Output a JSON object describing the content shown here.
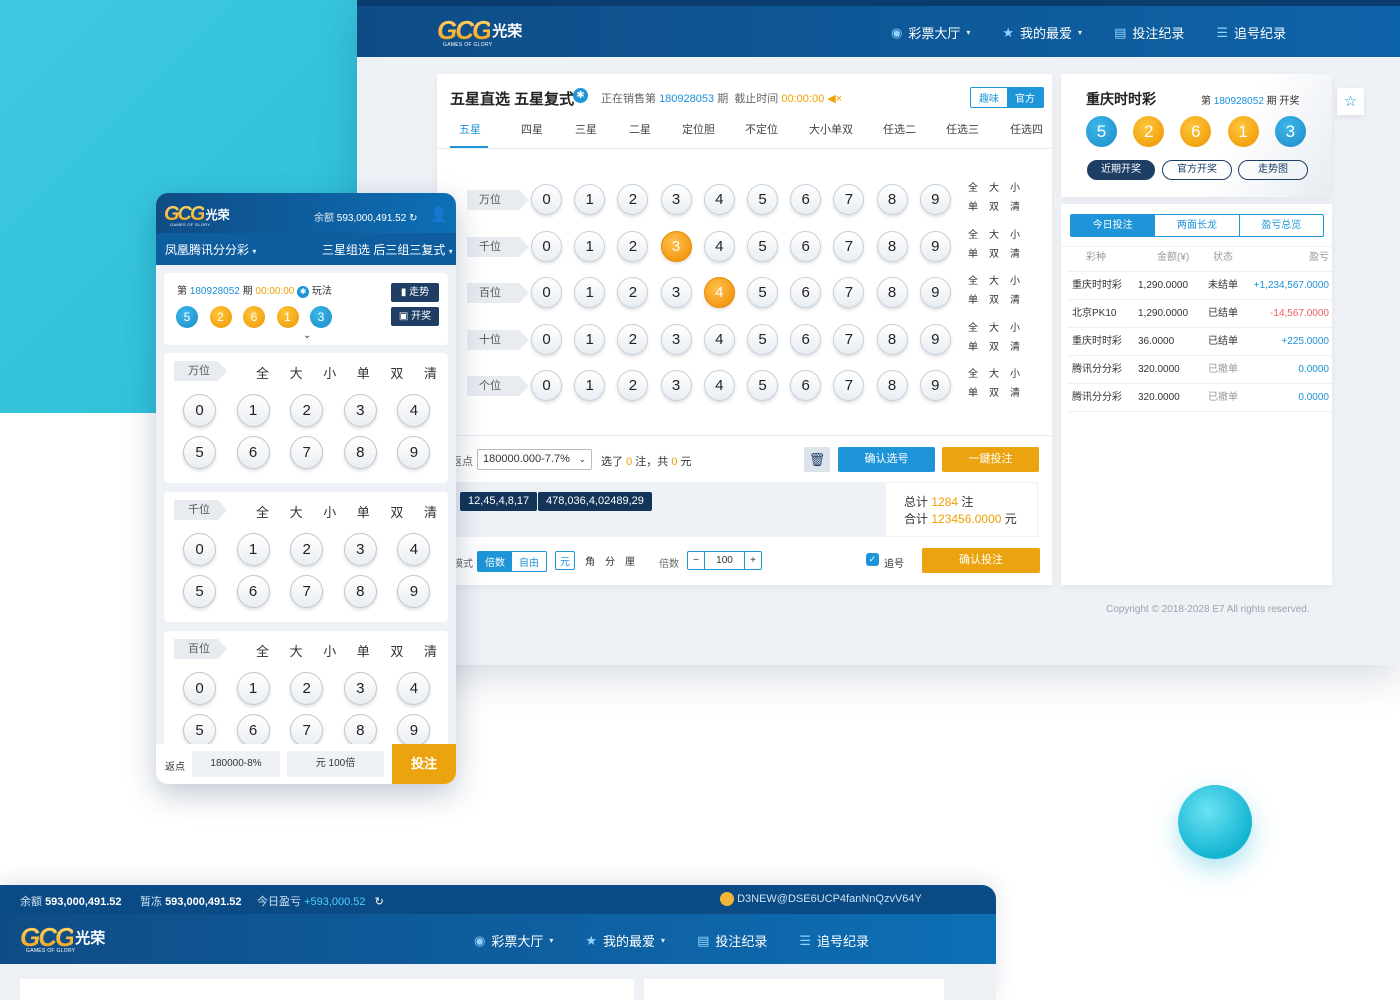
{
  "desktop": {
    "logo": {
      "brand": "GCG",
      "name": "光荣",
      "sub": "GAMES OF GLORY"
    },
    "nav": [
      {
        "label": "彩票大厅",
        "icon": "lottery-icon",
        "dropdown": true
      },
      {
        "label": "我的最爱",
        "icon": "star-icon",
        "dropdown": true
      },
      {
        "label": "投注纪录",
        "icon": "clipboard-icon",
        "dropdown": false
      },
      {
        "label": "追号纪录",
        "icon": "list-icon",
        "dropdown": false
      }
    ],
    "play": {
      "title": "五星直选 五星复式",
      "selling_label": "正在销售第",
      "period": "180928053",
      "period_suffix": "期",
      "deadline_label": "截止时间",
      "deadline": "00:00:00",
      "mode_tabs": [
        "趣味",
        "官方"
      ],
      "tabs": [
        "五星",
        "四星",
        "三星",
        "二星",
        "定位胆",
        "不定位",
        "大小单双",
        "任选二",
        "任选三",
        "任选四"
      ],
      "active_tab": "五星",
      "rows": [
        {
          "label": "万位",
          "selected": []
        },
        {
          "label": "千位",
          "selected": [
            3
          ]
        },
        {
          "label": "百位",
          "selected": [
            4
          ]
        },
        {
          "label": "十位",
          "selected": []
        },
        {
          "label": "个位",
          "selected": []
        }
      ],
      "digits": [
        "0",
        "1",
        "2",
        "3",
        "4",
        "5",
        "6",
        "7",
        "8",
        "9"
      ],
      "quick": {
        "all": "全",
        "big": "大",
        "small": "小",
        "odd": "单",
        "even": "双",
        "clear": "清"
      },
      "rebate_label": "返点",
      "rebate_value": "180000.000-7.7%",
      "picked_text": "选了",
      "picked_count": "0",
      "picked_mid": "注，共",
      "picked_amount": "0",
      "picked_unit": "元",
      "confirm_pick": "确认选号",
      "one_click": "一鍵投注",
      "chips": [
        "12,45,4,8,17",
        "478,036,4,02489,29"
      ],
      "total_label": "总计",
      "total_bets": "1284",
      "total_bets_unit": "注",
      "sum_label": "合计",
      "sum_amount": "123456.0000",
      "sum_unit": "元",
      "mode_label": "模式",
      "mode_opts": [
        "倍数",
        "自由"
      ],
      "unit_opts": [
        "元",
        "角",
        "分",
        "厘"
      ],
      "multiple_label": "倍数",
      "multiple_value": "100",
      "chase_label": "追号",
      "confirm_bet": "确认投注"
    },
    "draw": {
      "title": "重庆时时彩",
      "period_prefix": "第",
      "period": "180928052",
      "period_suffix": "期 开奖",
      "numbers": [
        "5",
        "2",
        "6",
        "1",
        "3"
      ],
      "ball_colors": [
        "blue",
        "orange",
        "orange",
        "orange",
        "blue"
      ],
      "buttons": [
        "近期开奖",
        "官方开奖",
        "走势图"
      ]
    },
    "bets": {
      "tabs": [
        "今日投注",
        "两面长龙",
        "盈亏总览"
      ],
      "headers": [
        "彩种",
        "金额(¥)",
        "状态",
        "盈亏"
      ],
      "rows": [
        {
          "game": "重庆时时彩",
          "amount": "1,290.0000",
          "status": "未结单",
          "pl": "+1,234,567.0000",
          "pl_color": "#1a8fd8"
        },
        {
          "game": "北京PK10",
          "amount": "1,290.0000",
          "status": "已结单",
          "pl": "-14,567.0000",
          "pl_color": "#f25b5b"
        },
        {
          "game": "重庆时时彩",
          "amount": "36.0000",
          "status": "已结单",
          "pl": "+225.0000",
          "pl_color": "#1a8fd8"
        },
        {
          "game": "腾讯分分彩",
          "amount": "320.0000",
          "status": "已撤单",
          "pl": "0.0000",
          "pl_color": "#1a8fd8"
        },
        {
          "game": "腾讯分分彩",
          "amount": "320.0000",
          "status": "已撤单",
          "pl": "0.0000",
          "pl_color": "#1a8fd8"
        }
      ]
    },
    "copyright": "Copyright © 2018-2028 E7 All rights reserved."
  },
  "mobile": {
    "balance_label": "余额",
    "balance": "593,000,491.52",
    "game": "凤凰腾讯分分彩",
    "play": "三星组选 后三组三复式",
    "period_prefix": "第",
    "period": "180928052",
    "period_suffix": "期",
    "time": "00:00:00",
    "howto": "玩法",
    "trend": "走势",
    "draw": "开奖",
    "numbers": [
      "5",
      "2",
      "6",
      "1",
      "3"
    ],
    "ball_colors": [
      "blue",
      "orange",
      "orange",
      "orange",
      "blue"
    ],
    "sections": [
      {
        "label": "万位"
      },
      {
        "label": "千位"
      },
      {
        "label": "百位"
      }
    ],
    "quick": [
      "全",
      "大",
      "小",
      "单",
      "双",
      "清"
    ],
    "digits": [
      "0",
      "1",
      "2",
      "3",
      "4",
      "5",
      "6",
      "7",
      "8",
      "9"
    ],
    "footer": {
      "rebate_label": "返点",
      "rebate": "180000-8%",
      "unit": "元 100倍",
      "bet": "投注"
    }
  },
  "bottom": {
    "balance_label": "余额",
    "balance": "593,000,491.52",
    "frozen_label": "暂冻",
    "frozen": "593,000,491.52",
    "profit_label": "今日盈亏",
    "profit": "+593,000.52",
    "user": "D3NEW@DSE6UCP4fanNnQzvV64Y",
    "nav": [
      "彩票大厅",
      "我的最爱",
      "投注纪录",
      "追号纪录"
    ]
  }
}
